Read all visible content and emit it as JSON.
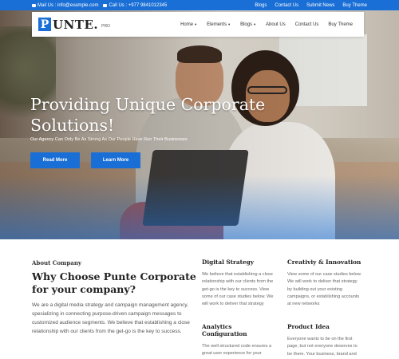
{
  "topbar": {
    "mail": "Mail Us : info@example.com",
    "call": "Call Us : +977 9841012345",
    "links": [
      "Blogs",
      "Contact Us",
      "Submit News",
      "Buy Theme"
    ]
  },
  "header": {
    "logo_letter": "P",
    "logo_text": "UNTE.",
    "logo_sub": "PRO",
    "nav": [
      {
        "label": "Home",
        "dropdown": true
      },
      {
        "label": "Elements",
        "dropdown": true
      },
      {
        "label": "Blogs",
        "dropdown": true
      },
      {
        "label": "About Us",
        "dropdown": false
      },
      {
        "label": "Contact Us",
        "dropdown": false
      },
      {
        "label": "Buy Theme",
        "dropdown": false
      }
    ]
  },
  "hero": {
    "title": "Providing Unique Corporate Solutions!",
    "subtitle": "Our Agency Can Only Be As Strong As Our People Have Run Their Businesses",
    "read_more": "Read More",
    "learn_more": "Learn More"
  },
  "about": {
    "label": "About Company",
    "title": "Why Choose Punte Corporate for your company?",
    "text": "We are a digital media strategy and campaign management agency, specializing in connecting purpose-driven campaign messages to customized audience segments. We believe that establishing a close relationship with our clients from the get-go is the key to success."
  },
  "features": [
    {
      "title": "Digital Strategy",
      "text": "We believe that establishing a close relationship with our clients from the get-go is the key to success. View some of our case studies below. We will work to deliver that strategy"
    },
    {
      "title": "Creativiy & Innovation",
      "text": "View some of our case studies below. We will work to deliver that strategy by building out your existing campaigns, or establishing accounts at new networks"
    },
    {
      "title": "Analytics Configuration",
      "text": "The well structured code ensures a great user experience for your visitors. Image optimization, lazy load,"
    },
    {
      "title": "Product Idea",
      "text": "Everyone wants to be on the first page, but not everyone deserves to be there. Your business, brand and"
    }
  ],
  "colors": {
    "accent": "#1a6fd6"
  }
}
